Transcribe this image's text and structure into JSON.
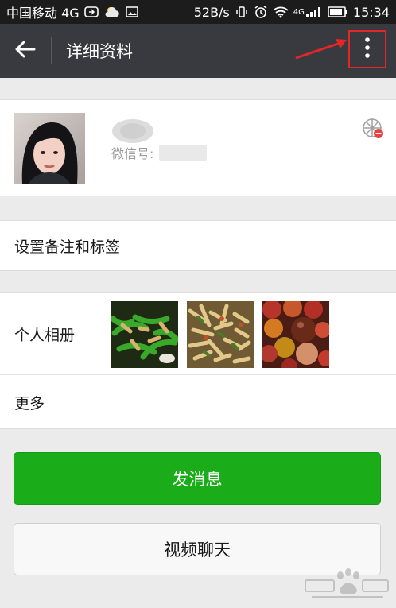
{
  "status_bar": {
    "carrier": "中国移动 4G",
    "speed": "52B/s",
    "network": "4G",
    "time": "15:34"
  },
  "header": {
    "title": "详细资料",
    "back_icon": "back-arrow-icon",
    "more_icon": "more-vertical-icon"
  },
  "profile": {
    "wechat_id_label": "微信号:",
    "moments_icon": "moments-icon"
  },
  "remark": {
    "label": "设置备注和标签"
  },
  "album": {
    "label": "个人相册",
    "thumbnails": [
      "dish-peppers",
      "dish-stirfry",
      "fruit-persimmons"
    ]
  },
  "more": {
    "label": "更多"
  },
  "actions": {
    "send_message": "发消息",
    "video_chat": "视频聊天"
  },
  "colors": {
    "title_bar": "#393a3f",
    "primary_button": "#1aad19",
    "annotation_red": "#e02828"
  }
}
